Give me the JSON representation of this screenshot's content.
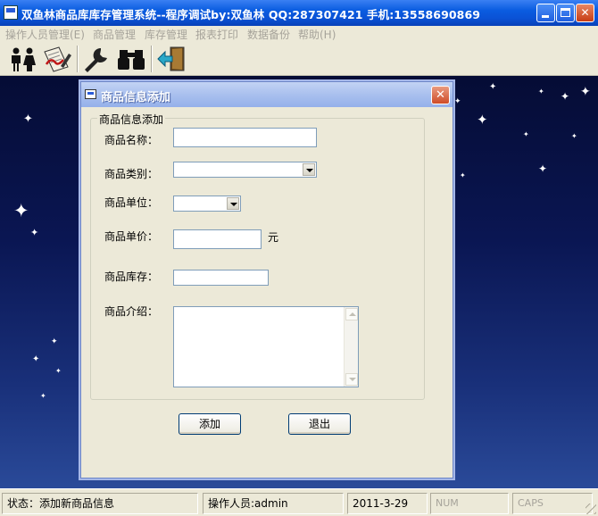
{
  "window": {
    "title": "双鱼林商品库库存管理系统--程序调试by:双鱼林 QQ:287307421 手机:13558690869",
    "minimize_icon": "minimize-icon",
    "maximize_icon": "maximize-icon",
    "close_label": "✕"
  },
  "menubar": {
    "items": [
      {
        "label": "操作人员管理(E)"
      },
      {
        "label": "商品管理"
      },
      {
        "label": "库存管理"
      },
      {
        "label": "报表打印"
      },
      {
        "label": "数据备份"
      },
      {
        "label": "帮助(H)"
      }
    ]
  },
  "toolbar": {
    "tools": [
      {
        "icon": "users-icon"
      },
      {
        "icon": "edit-document-icon"
      },
      {
        "icon": "wrench-icon"
      },
      {
        "icon": "binoculars-icon"
      },
      {
        "icon": "exit-door-icon"
      }
    ]
  },
  "dialog": {
    "title": "商品信息添加",
    "close_label": "✕",
    "group_title": "商品信息添加",
    "fields": {
      "name": {
        "label": "商品名称：",
        "value": ""
      },
      "category": {
        "label": "商品类别：",
        "value": ""
      },
      "unit": {
        "label": "商品单位：",
        "value": ""
      },
      "price": {
        "label": "商品单价：",
        "value": "",
        "suffix": "元"
      },
      "stock": {
        "label": "商品库存：",
        "value": ""
      },
      "intro": {
        "label": "商品介绍：",
        "value": ""
      }
    },
    "buttons": {
      "add": "添加",
      "exit": "退出"
    }
  },
  "statusbar": {
    "status": "状态：添加新商品信息",
    "operator": "操作人员:admin",
    "date": "2011-3-29",
    "num": "NUM",
    "caps": "CAPS"
  },
  "colors": {
    "accent": "#0a5ce0",
    "dialog_title": "#a9c0ee",
    "background_sky": "#0a1653"
  }
}
